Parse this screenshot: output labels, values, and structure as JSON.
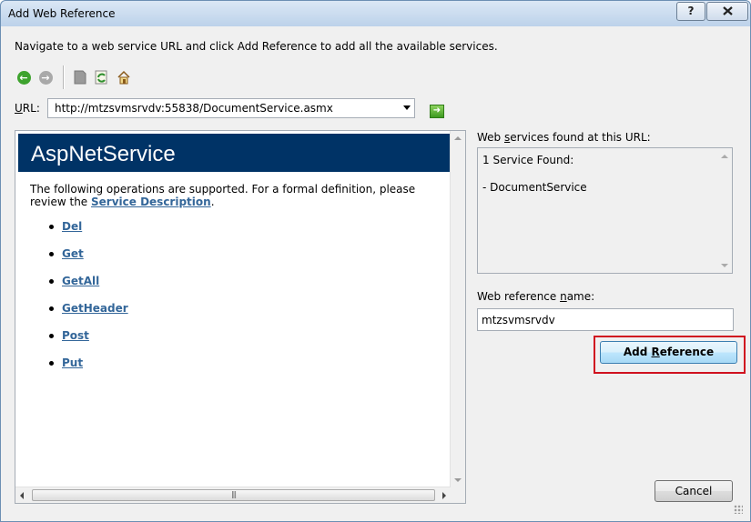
{
  "window": {
    "title": "Add Web Reference",
    "help_label": "?",
    "close_label": "X"
  },
  "instructions": "Navigate to a web service URL and click Add Reference to add all the available services.",
  "toolbar": {
    "icons": [
      "back-icon",
      "forward-icon",
      "stop-icon",
      "refresh-icon",
      "home-icon"
    ]
  },
  "url": {
    "label_prefix": "U",
    "label_rest": "RL:",
    "value": "http://mtzsvmsrvdv:55838/DocumentService.asmx"
  },
  "browser": {
    "service_name": "AspNetService",
    "desc_text": "The following operations are supported. For a formal definition, please review the ",
    "desc_link": "Service Description",
    "desc_end": ".",
    "operations": [
      "Del",
      "Get",
      "GetAll",
      "GetHeader",
      "Post",
      "Put"
    ]
  },
  "services_panel": {
    "label_part1": "Web ",
    "label_access": "s",
    "label_part2": "ervices found at this URL:",
    "count_text": "1 Service Found:",
    "service_item": "- DocumentService"
  },
  "reference": {
    "label_part1": "Web reference ",
    "label_access": "n",
    "label_part2": "ame:",
    "value": "mtzsvmsrvdv"
  },
  "buttons": {
    "add_ref_part1": "Add ",
    "add_ref_access": "R",
    "add_ref_part2": "eference",
    "cancel": "Cancel"
  },
  "colors": {
    "header_bg": "#003366",
    "link": "#336699",
    "highlight": "#d0121f"
  }
}
